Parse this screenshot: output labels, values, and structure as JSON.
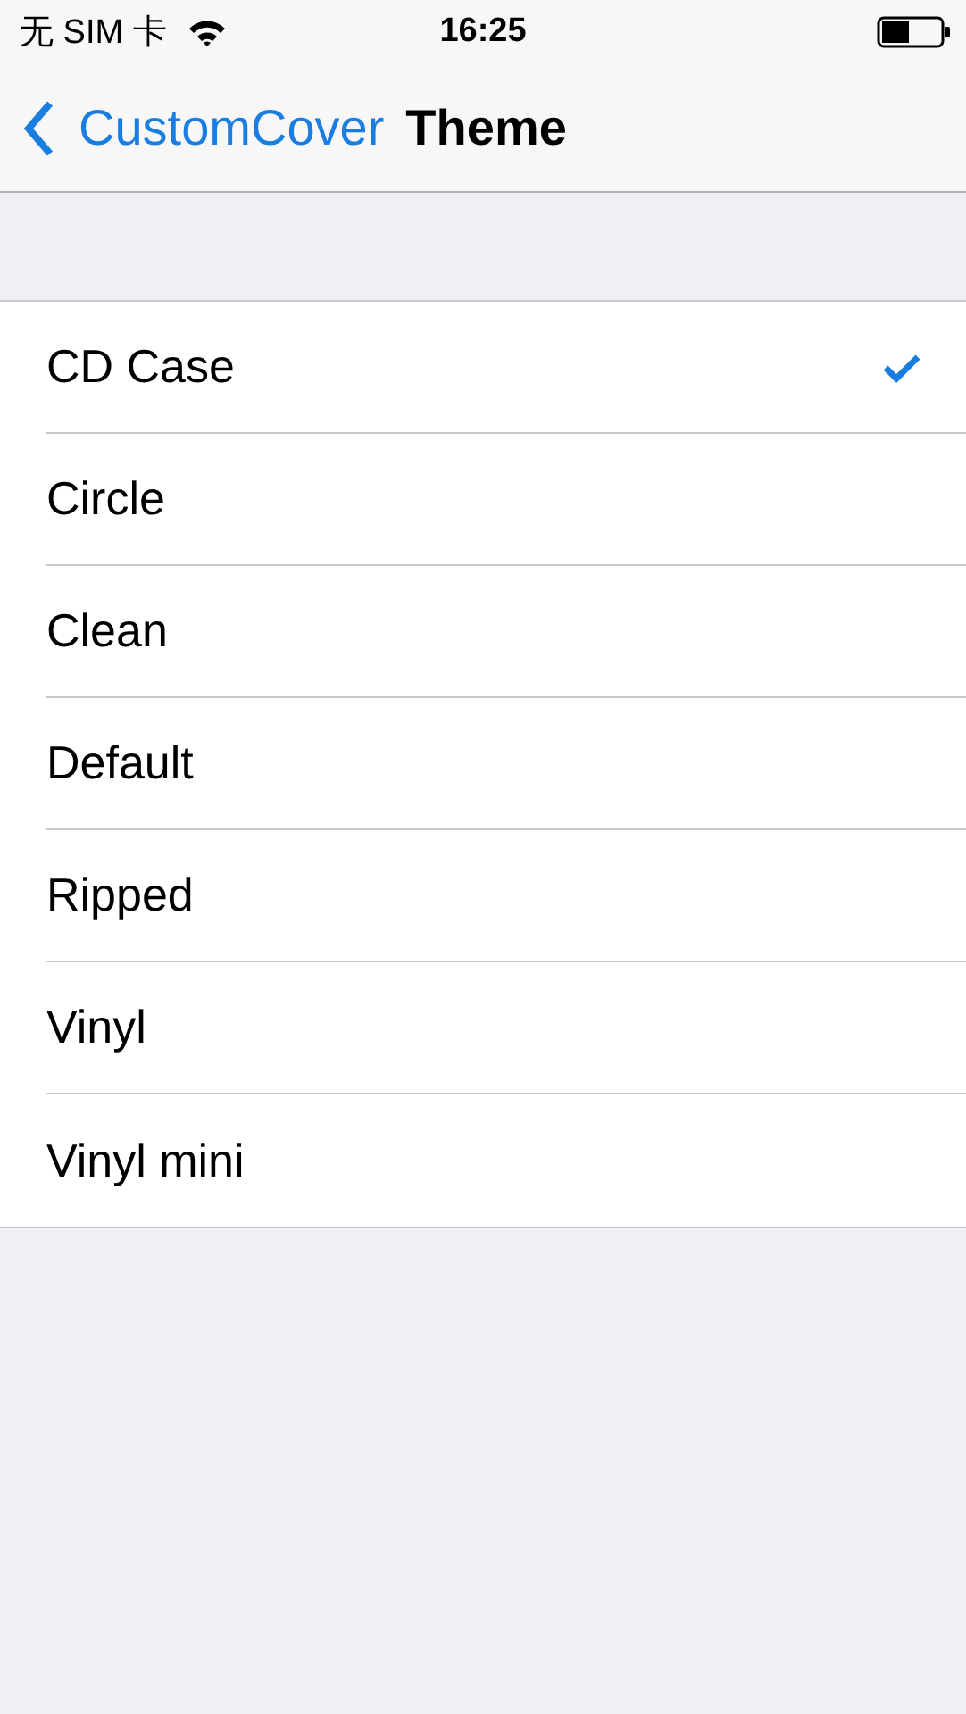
{
  "status_bar": {
    "carrier": "无 SIM 卡",
    "time": "16:25"
  },
  "nav_bar": {
    "back": "CustomCover",
    "title": "Theme"
  },
  "options": [
    {
      "label": "CD Case",
      "selected": true
    },
    {
      "label": "Circle",
      "selected": false
    },
    {
      "label": "Clean",
      "selected": false
    },
    {
      "label": "Default",
      "selected": false
    },
    {
      "label": "Ripped",
      "selected": false
    },
    {
      "label": "Vinyl",
      "selected": false
    },
    {
      "label": "Vinyl mini",
      "selected": false
    }
  ]
}
